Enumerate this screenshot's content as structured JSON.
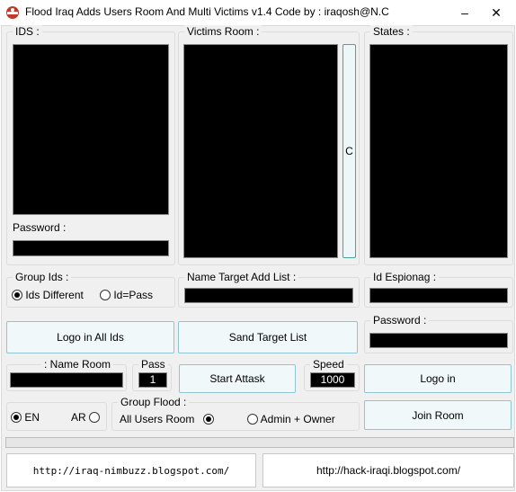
{
  "window": {
    "title": "Flood Iraq Adds Users Room And Multi Victims v1.4 Code by : iraqosh@N.C",
    "minimize_label": "–",
    "close_label": "✕"
  },
  "ids_panel": {
    "label": "IDS :",
    "password_label": "Password :"
  },
  "victims_panel": {
    "label": "Victims Room :",
    "clear_label": "C"
  },
  "states_panel": {
    "label": "States :"
  },
  "group_ids": {
    "label": "Group Ids :",
    "option1": "Ids Different",
    "option2": "Id=Pass",
    "selected": "Ids Different"
  },
  "name_target": {
    "label": "Name Target  Add List :"
  },
  "id_espionag": {
    "label": "Id Espionag :"
  },
  "password2": {
    "label": "Password :"
  },
  "buttons": {
    "logo_all": "Logo in All Ids",
    "sand_target": "Sand Target List",
    "start": "Start Attask",
    "logo_in": "Logo in",
    "join_room": "Join Room"
  },
  "name_room": {
    "label": ": Name Room"
  },
  "pass": {
    "label": "Pass",
    "value": "1"
  },
  "speed": {
    "label": "Speed",
    "value": "1000"
  },
  "language": {
    "en": "EN",
    "ar": "AR",
    "selected": "EN"
  },
  "group_flood": {
    "label": "Group Flood :",
    "option1": "All Users Room",
    "option2": "Admin + Owner",
    "selected": "All Users Room"
  },
  "links": {
    "left": "http://iraq-nimbuzz.blogspot.com/",
    "right": "http://hack-iraqi.blogspot.com/"
  }
}
